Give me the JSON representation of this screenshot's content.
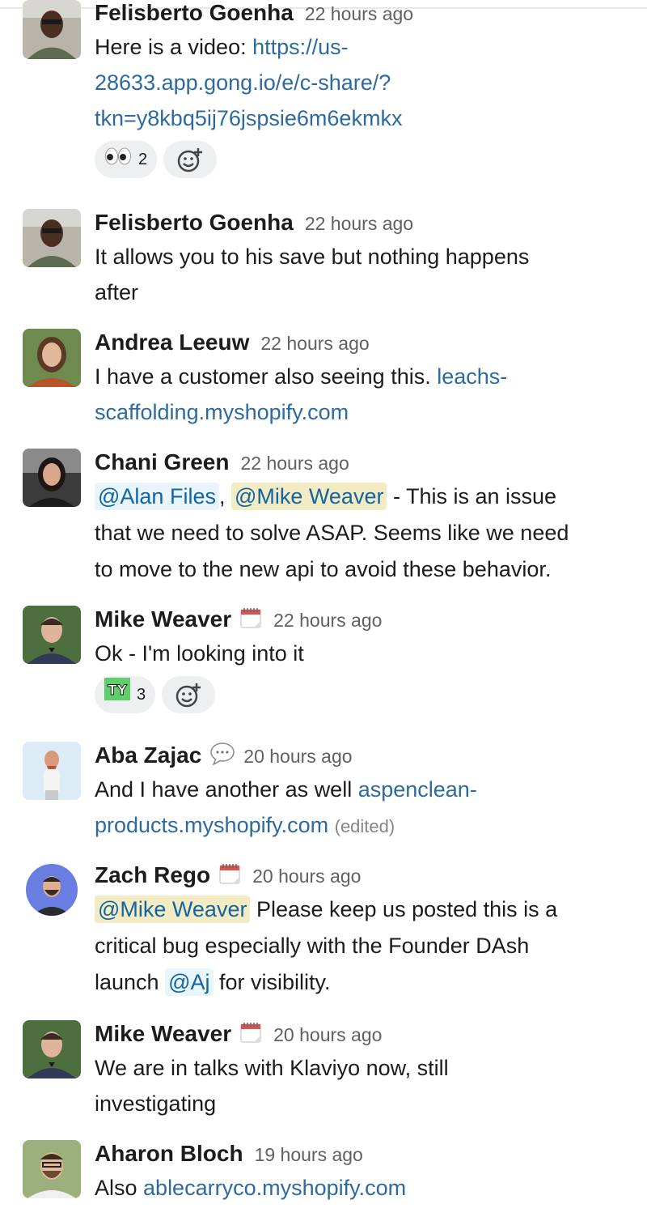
{
  "messages": [
    {
      "author": "Felisberto Goenha",
      "time": "22 hours ago",
      "text_prefix": "Here is a video: ",
      "link_line1": "https://us-",
      "link_line2": "28633.app.gong.io/e/c-share/?",
      "link_line3": "tkn=y8kbq5ij76jspsie6m6ekmkx",
      "reactions": [
        {
          "emoji": "eyes",
          "count": "2"
        }
      ]
    },
    {
      "author": "Felisberto Goenha",
      "time": "22 hours ago",
      "line1": "It allows you to his save but nothing happens",
      "line2": "after"
    },
    {
      "author": "Andrea Leeuw",
      "time": "22 hours ago",
      "line1_text": "I have a customer also seeing this. ",
      "line1_link": "leachs-",
      "line2_link": "scaffolding.myshopify.com"
    },
    {
      "author": "Chani Green",
      "time": "22 hours ago",
      "mention1": "@Alan Files",
      "sep": ",",
      "mention2": "@Mike Weaver",
      "line1_rest": " - This is an issue",
      "line2": "that we need to solve ASAP. Seems like we need",
      "line3": "to move to the new api to avoid these behavior."
    },
    {
      "author": "Mike Weaver",
      "time": "22 hours ago",
      "status_icon": "calendar-icon",
      "text": "Ok - I'm looking into it",
      "reactions": [
        {
          "emoji": "TY",
          "count": "3"
        }
      ]
    },
    {
      "author": "Aba Zajac",
      "time": "20 hours ago",
      "status_icon": "speech-bubble-icon",
      "line1_text": "And I have another as well ",
      "line1_link": "aspenclean-",
      "line2_link": "products.myshopify.com",
      "edited": "(edited)"
    },
    {
      "author": "Zach Rego",
      "time": "20 hours ago",
      "status_icon": "calendar-icon",
      "mention": "@Mike Weaver",
      "line1_rest": " Please keep us posted this is a",
      "line2": "critical bug especially with the Founder DAsh",
      "line3_text": "launch ",
      "line3_mention": "@Aj",
      "line3_rest": " for visibility."
    },
    {
      "author": "Mike Weaver",
      "time": "20 hours ago",
      "status_icon": "calendar-icon",
      "line1": "We are in talks with Klaviyo now, still",
      "line2": "investigating"
    },
    {
      "author": "Aharon Bloch",
      "time": "19 hours ago",
      "text_prefix": "Also ",
      "link": "ablecarryco.myshopify.com"
    }
  ],
  "colors": {
    "link": "#2d6aa0",
    "mention_bg": "#e8f5fa",
    "mention_self_bg": "#f2ebc4",
    "reaction_bg": "#eeeff0"
  }
}
